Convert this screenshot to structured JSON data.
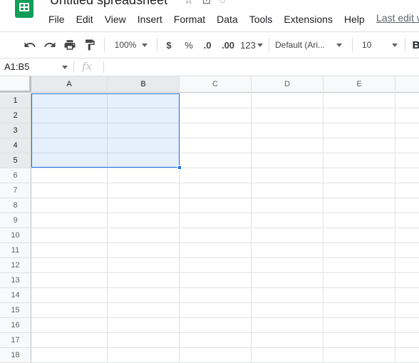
{
  "document": {
    "title": "Untitled spreadsheet"
  },
  "menu": {
    "items": [
      "File",
      "Edit",
      "View",
      "Insert",
      "Format",
      "Data",
      "Tools",
      "Extensions",
      "Help"
    ],
    "last_edit": "Last edit w"
  },
  "toolbar": {
    "zoom": "100%",
    "currency": "$",
    "percent": "%",
    "decimal_decrease": ".0",
    "decimal_increase": ".00",
    "more_formats": "123",
    "font": "Default (Ari...",
    "font_size": "10",
    "bold": "B"
  },
  "formula_bar": {
    "name_box": "A1:B5",
    "fx": "fx",
    "value": ""
  },
  "sheet": {
    "columns": [
      "A",
      "B",
      "C",
      "D",
      "E"
    ],
    "rows": [
      "1",
      "2",
      "3",
      "4",
      "5",
      "6",
      "7",
      "8",
      "9",
      "10",
      "11",
      "12",
      "13",
      "14",
      "15",
      "16",
      "17",
      "18"
    ],
    "selection": "A1:B5"
  },
  "colors": {
    "brand": "#0f9d58",
    "selection": "#1a73e8"
  }
}
